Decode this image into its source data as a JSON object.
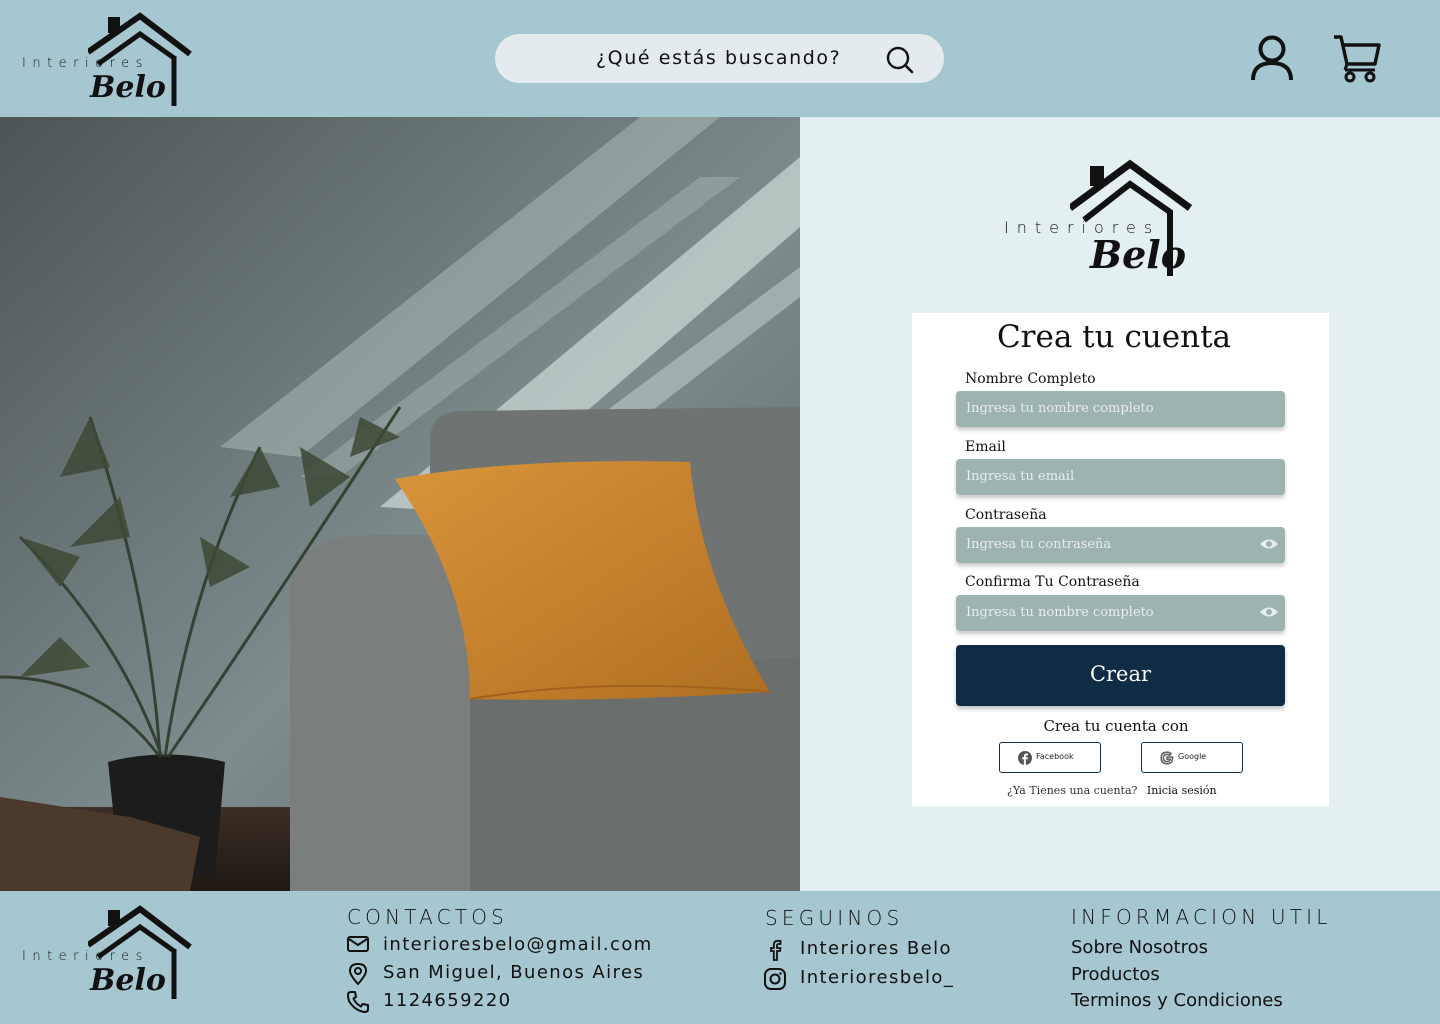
{
  "header": {
    "logo": {
      "word": "Interiores",
      "brand": "Belo"
    },
    "search_placeholder": "¿Qué estás buscando?",
    "icons": [
      "search-icon",
      "user-icon",
      "cart-icon"
    ]
  },
  "form": {
    "logo": {
      "word": "Interiores",
      "brand": "Belo"
    },
    "title": "Crea tu cuenta",
    "fields": [
      {
        "label": "Nombre Completo",
        "placeholder": "Ingresa tu nombre completo"
      },
      {
        "label": "Email",
        "placeholder": "Ingresa tu email"
      },
      {
        "label": "Contraseña",
        "placeholder": "Ingresa tu contraseña"
      },
      {
        "label": "Confirma Tu Contraseña",
        "placeholder": "Ingresa tu nombre completo"
      }
    ],
    "submit_label": "Crear",
    "social_title": "Crea tu cuenta con",
    "social": [
      {
        "label": "Facebook"
      },
      {
        "label": "Google"
      }
    ],
    "signin_question": "¿Ya Tienes una cuenta?",
    "signin_link": "Inicia sesión"
  },
  "footer": {
    "logo": {
      "word": "Interiores",
      "brand": "Belo"
    },
    "contacts": {
      "title": "CONTACTOS",
      "email": "interioresbelo@gmail.com",
      "address": "San Miguel, Buenos Aires",
      "phone": "1124659220"
    },
    "follow": {
      "title": "SEGUINOS",
      "facebook": "Interiores Belo",
      "instagram": "Interioresbelo_"
    },
    "info": {
      "title": "INFORMACION UTIL",
      "links": [
        "Sobre Nosotros",
        "Productos",
        "Terminos y Condiciones"
      ]
    }
  },
  "colors": {
    "header_bg": "#a6c7d1",
    "page_bg": "#e3eff0",
    "field_bg": "#9db3b0",
    "button_bg": "#102c44",
    "pillow": "#c8822d",
    "sofa": "#6e7170"
  }
}
